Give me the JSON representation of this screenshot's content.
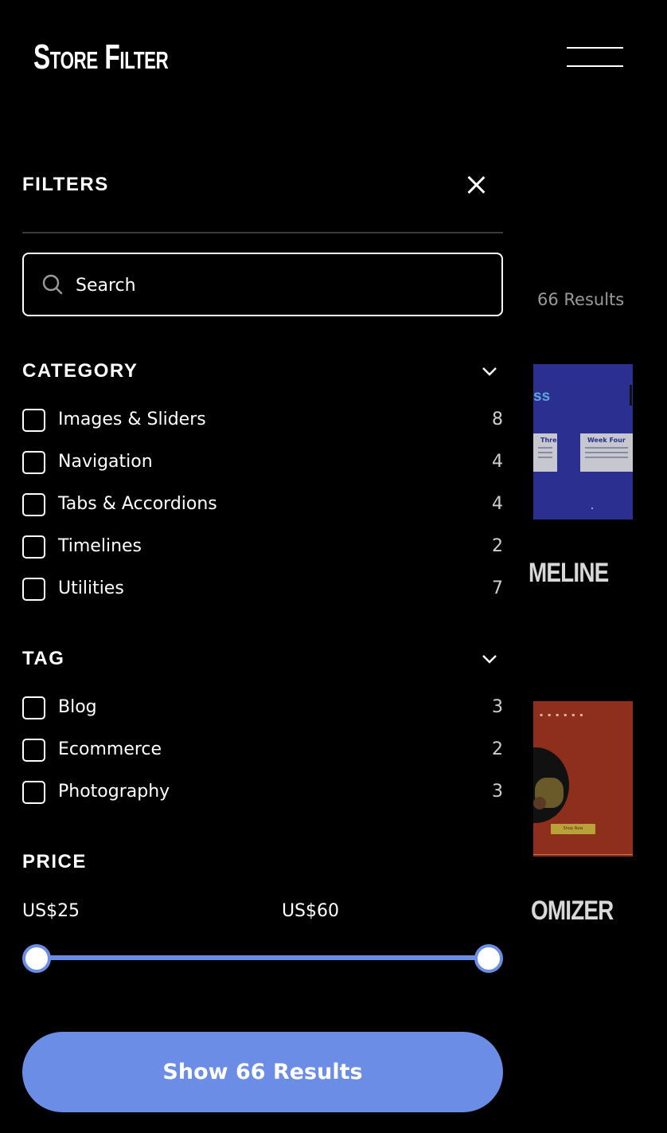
{
  "header": {
    "logo": "Store Filter",
    "menu_icon": "hamburger-icon"
  },
  "background": {
    "results_count": "66 Results",
    "cards": [
      {
        "title_fragment": "MELINE",
        "preview_heading": "ss",
        "preview_boxes": [
          "Three",
          "Week Four"
        ]
      },
      {
        "title_fragment": "OMIZER",
        "preview_button": "Shop Now"
      }
    ]
  },
  "filters": {
    "title": "FILTERS",
    "close_icon": "close-icon",
    "search": {
      "placeholder": "Search",
      "value": ""
    },
    "category": {
      "title": "CATEGORY",
      "options": [
        {
          "label": "Images & Sliders",
          "count": "8",
          "checked": false
        },
        {
          "label": "Navigation",
          "count": "4",
          "checked": false
        },
        {
          "label": "Tabs & Accordions",
          "count": "4",
          "checked": false
        },
        {
          "label": "Timelines",
          "count": "2",
          "checked": false
        },
        {
          "label": "Utilities",
          "count": "7",
          "checked": false
        }
      ]
    },
    "tag": {
      "title": "TAG",
      "options": [
        {
          "label": "Blog",
          "count": "3",
          "checked": false
        },
        {
          "label": "Ecommerce",
          "count": "2",
          "checked": false
        },
        {
          "label": "Photography",
          "count": "3",
          "checked": false
        }
      ]
    },
    "price": {
      "title": "PRICE",
      "min_label": "US$25",
      "max_label": "US$60",
      "range": [
        25,
        60
      ],
      "selected": [
        25,
        60
      ]
    },
    "submit_label": "Show 66 Results"
  },
  "colors": {
    "accent": "#6b8de6",
    "background": "#000000",
    "text": "#ffffff"
  }
}
